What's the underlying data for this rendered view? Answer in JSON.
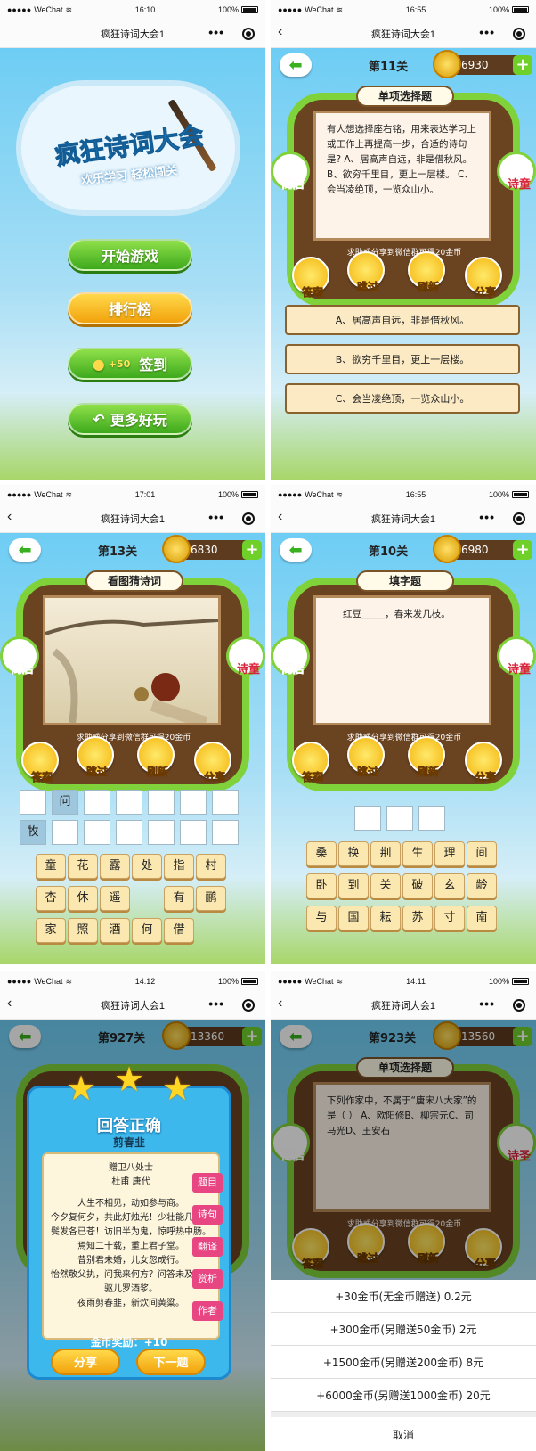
{
  "common": {
    "carrier": "WeChat",
    "battery": "100%",
    "nav_title": "疯狂诗词大会1",
    "nav_more": "•••",
    "back_glyph": "‹",
    "hint": "求助或分享到微信群可得20金币",
    "shop": "商店",
    "tools": [
      "答案",
      "跳过",
      "刷新",
      "分享"
    ]
  },
  "s1": {
    "time": "16:10",
    "title": "疯狂诗词大会",
    "subtitle": "欢乐学习 轻松闯关",
    "start": "开始游戏",
    "rank": "排行榜",
    "signin_bonus": "+50",
    "signin": "签到",
    "more": "更多好玩"
  },
  "s2": {
    "time": "16:55",
    "level": "第11关",
    "coins": "6930",
    "mode": "单项选择题",
    "question": "有人想选择座右铭，用来表达学习上或工作上再提高一步，合适的诗句是? A、居高声自远，非是借秋风。 B、欲穷千里目，更上一层楼。 C、会当凌绝顶，一览众山小。",
    "poet": "诗童",
    "options": [
      "A、居高声自远，非是借秋风。",
      "B、欲穷千里目，更上一层楼。",
      "C、会当凌绝顶，一览众山小。"
    ]
  },
  "s3": {
    "time": "17:01",
    "level": "第13关",
    "coins": "6830",
    "mode": "看图猜诗词",
    "poet": "诗童",
    "row1_fill": "问",
    "row2_fill": "牧",
    "keys": [
      "童",
      "花",
      "露",
      "处",
      "指",
      "村",
      "杏",
      "休",
      "遥",
      "",
      "有",
      "鹂",
      "家",
      "照",
      "酒",
      "何",
      "借"
    ]
  },
  "s4": {
    "time": "16:55",
    "level": "第10关",
    "coins": "6980",
    "mode": "填字题",
    "question": "红豆_____，春来发几枝。",
    "poet": "诗童",
    "keys": [
      "桑",
      "换",
      "荆",
      "生",
      "理",
      "间",
      "卧",
      "到",
      "关",
      "破",
      "玄",
      "龄",
      "与",
      "国",
      "耘",
      "苏",
      "寸",
      "南"
    ]
  },
  "s5": {
    "time": "14:12",
    "level": "第927关",
    "coins": "13360",
    "correct": "回答正确",
    "answer": "剪春韭",
    "poem_title": "赠卫八处士",
    "poem_author": "杜甫 唐代",
    "poem_lines": [
      "人生不相见，动如参与商。",
      "今夕复何夕，共此灯烛光！少壮能几时？鬓发各已苍！访旧半为鬼，惊呼热中肠。",
      "焉知二十载，重上君子堂。",
      "昔别君未婚，儿女忽成行。",
      "怡然敬父执，问我来何方？问答未及已，驱儿罗酒浆。",
      "夜雨剪春韭，新炊间黄粱。"
    ],
    "tabs": [
      "题目",
      "诗句",
      "翻译",
      "赏析",
      "作者"
    ],
    "reward": "金币奖励：+10",
    "share": "分享",
    "next": "下一题"
  },
  "s6": {
    "time": "14:11",
    "level": "第923关",
    "coins": "13560",
    "mode": "单项选择题",
    "question": "下列作家中，不属于“唐宋八大家”的是（  ） A、欧阳修B、柳宗元C、司马光D、王安石",
    "poet": "诗圣",
    "sheet": [
      "+30金币(无金币赠送) 0.2元",
      "+300金币(另赠送50金币) 2元",
      "+1500金币(另赠送200金币) 8元",
      "+6000金币(另赠送1000金币) 20元"
    ],
    "cancel": "取消"
  }
}
